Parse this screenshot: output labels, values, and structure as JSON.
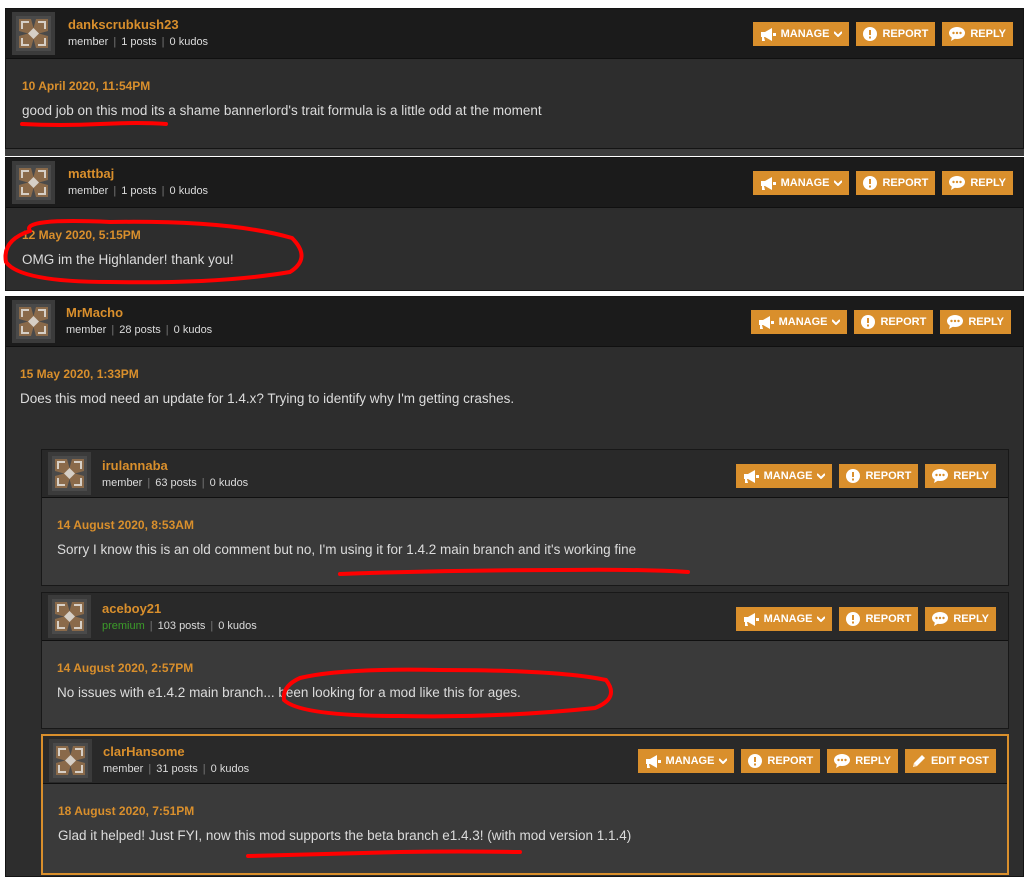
{
  "buttons": {
    "manage": "MANAGE",
    "report": "REPORT",
    "reply": "REPLY",
    "edit_post": "EDIT POST"
  },
  "comments": [
    {
      "username": "dankscrubkush23",
      "role": "member",
      "posts": "1 posts",
      "kudos": "0 kudos",
      "date": "10 April 2020, 11:54PM",
      "text": "good job on this mod its a shame bannerlord's trait formula is a little odd at the moment"
    },
    {
      "username": "mattbaj",
      "role": "member",
      "posts": "1 posts",
      "kudos": "0 kudos",
      "date": "12 May 2020, 5:15PM",
      "text": "OMG im the Highlander! thank you!"
    },
    {
      "username": "MrMacho",
      "role": "member",
      "posts": "28 posts",
      "kudos": "0 kudos",
      "date": "15 May 2020, 1:33PM",
      "text": "Does this mod need an update for 1.4.x? Trying to identify why I'm getting crashes."
    }
  ],
  "replies": [
    {
      "username": "irulannaba",
      "role": "member",
      "posts": "63 posts",
      "kudos": "0 kudos",
      "date": "14 August 2020, 8:53AM",
      "text": "Sorry I know this is an old comment but no, I'm using it for 1.4.2 main branch and it's working fine"
    },
    {
      "username": "aceboy21",
      "role": "premium",
      "posts": "103 posts",
      "kudos": "0 kudos",
      "date": "14 August 2020, 2:57PM",
      "text": "No issues with e1.4.2 main branch... been looking for a mod like this for ages."
    },
    {
      "username": "clarHansome",
      "role": "member",
      "posts": "31 posts",
      "kudos": "0 kudos",
      "date": "18 August 2020, 7:51PM",
      "text": "Glad it helped! Just FYI, now this mod supports the beta branch e1.4.3! (with mod version 1.1.4)"
    }
  ],
  "colors": {
    "accent": "#d98f2c",
    "premium": "#3c9c2a",
    "annotation": "#ff0000"
  },
  "icons": {
    "manage": "megaphone-icon",
    "report": "exclamation-circle-icon",
    "reply": "speech-bubble-icon",
    "edit_post": "pencil-icon",
    "avatar": "default-avatar-icon"
  }
}
